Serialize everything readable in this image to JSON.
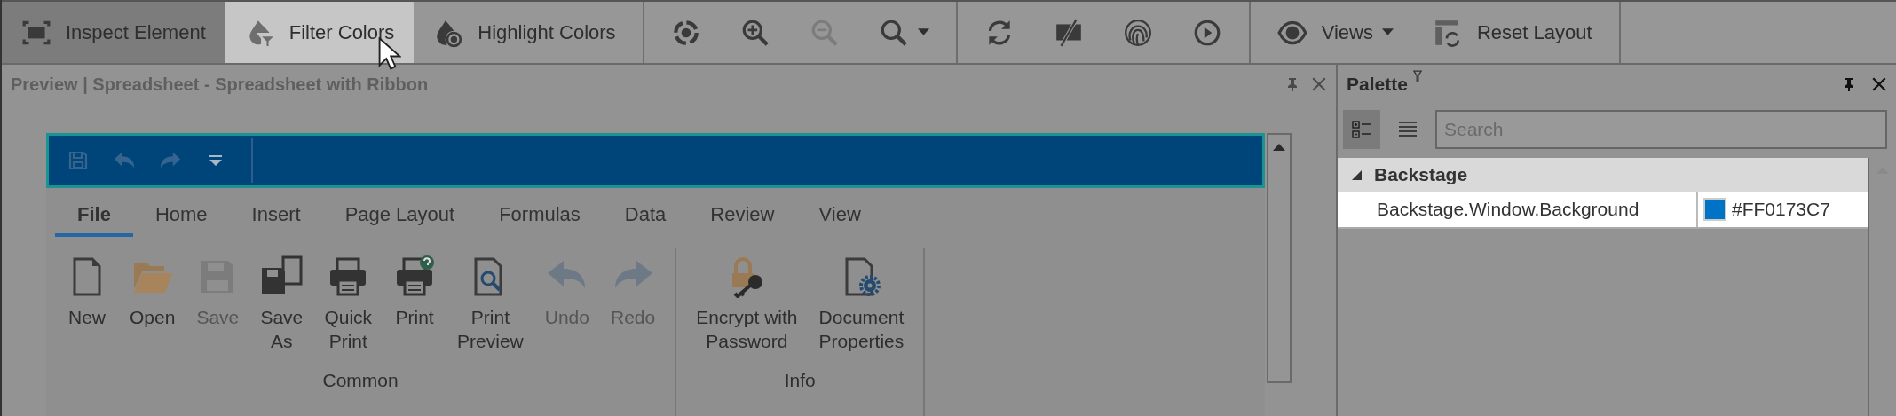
{
  "toolbar": {
    "groups": [
      [
        {
          "label": "Inspect Element",
          "pressed": true,
          "hovered": false,
          "disabled": false,
          "dropdown": false
        },
        {
          "label": "Filter Colors",
          "pressed": false,
          "hovered": true,
          "disabled": false,
          "dropdown": false
        },
        {
          "label": "Highlight Colors",
          "pressed": false,
          "hovered": false,
          "disabled": false,
          "dropdown": false
        }
      ],
      [
        {
          "pressed": false,
          "hovered": false,
          "disabled": false,
          "dropdown": false
        },
        {
          "pressed": false,
          "hovered": false,
          "disabled": false,
          "dropdown": false
        },
        {
          "pressed": false,
          "hovered": false,
          "disabled": true,
          "dropdown": false
        },
        {
          "pressed": false,
          "hovered": false,
          "disabled": false,
          "dropdown": true
        }
      ],
      [
        {
          "pressed": false,
          "hovered": false,
          "disabled": false,
          "dropdown": false
        },
        {
          "pressed": false,
          "hovered": false,
          "disabled": false,
          "dropdown": false
        },
        {
          "pressed": false,
          "hovered": false,
          "disabled": false,
          "dropdown": false
        },
        {
          "pressed": false,
          "hovered": false,
          "disabled": false,
          "dropdown": false
        }
      ],
      [
        {
          "label": "Views",
          "pressed": false,
          "hovered": false,
          "disabled": false,
          "dropdown": true
        },
        {
          "label": "Reset Layout",
          "pressed": false,
          "hovered": false,
          "disabled": false,
          "dropdown": false
        }
      ]
    ]
  },
  "preview": {
    "title": "Preview | Spreadsheet - Spreadsheet with Ribbon",
    "ribbon": {
      "tabs": [
        {
          "label": "File",
          "selected": true
        },
        {
          "label": "Home",
          "selected": false
        },
        {
          "label": "Insert",
          "selected": false
        },
        {
          "label": "Page Layout",
          "selected": false
        },
        {
          "label": "Formulas",
          "selected": false
        },
        {
          "label": "Data",
          "selected": false
        },
        {
          "label": "Review",
          "selected": false
        },
        {
          "label": "View",
          "selected": false
        }
      ],
      "groups": [
        {
          "label": "Common",
          "buttons": [
            {
              "label": "New",
              "disabled": false
            },
            {
              "label": "Open",
              "disabled": false
            },
            {
              "label": "Save",
              "disabled": true
            },
            {
              "label": "Save\nAs",
              "disabled": false
            },
            {
              "label": "Quick\nPrint",
              "disabled": false
            },
            {
              "label": "Print",
              "disabled": false
            },
            {
              "label": "Print\nPreview",
              "disabled": false
            },
            {
              "label": "Undo",
              "disabled": true
            },
            {
              "label": "Redo",
              "disabled": true
            }
          ]
        },
        {
          "label": "Info",
          "buttons": [
            {
              "label": "Encrypt with\nPassword",
              "disabled": false
            },
            {
              "label": "Document\nProperties",
              "disabled": false
            }
          ]
        }
      ]
    }
  },
  "palette": {
    "title": "Palette",
    "view_buttons": [
      {
        "selected": true
      },
      {
        "selected": false
      }
    ],
    "search": {
      "placeholder": "Search"
    },
    "categories": [
      {
        "name": "Backstage",
        "expanded": true,
        "rows": [
          {
            "name": "Backstage.Window.Background",
            "value": "#FF0173C7",
            "color": "#0173c7"
          }
        ]
      }
    ]
  }
}
